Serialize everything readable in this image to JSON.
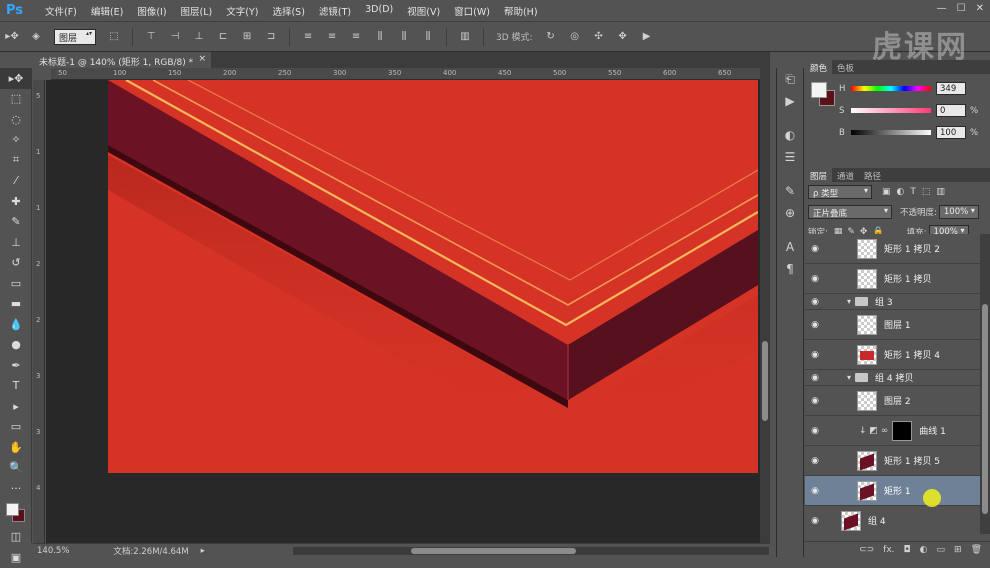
{
  "app": {
    "logo": "Ps"
  },
  "menu": [
    "文件(F)",
    "编辑(E)",
    "图像(I)",
    "图层(L)",
    "文字(Y)",
    "选择(S)",
    "滤镜(T)",
    "3D(D)",
    "视图(V)",
    "窗口(W)",
    "帮助(H)"
  ],
  "window_controls": [
    "—",
    "☐",
    "✕"
  ],
  "options_bar": {
    "select_value": "图层",
    "mode_3d_label": "3D 模式:"
  },
  "watermark": "虎课网",
  "document_tab": {
    "title": "未标题-1 @ 140% (矩形 1, RGB/8) *",
    "close": "×"
  },
  "ruler_top_ticks": [
    "50",
    "100",
    "150",
    "200",
    "250",
    "300",
    "350",
    "400",
    "450",
    "500",
    "550",
    "600",
    "650"
  ],
  "ruler_left_ticks": [
    "5",
    "1",
    "1",
    "2",
    "2",
    "3",
    "3",
    "4"
  ],
  "status": {
    "zoom": "140.5%",
    "doc_info": "文档:2.26M/4.64M"
  },
  "colors": {
    "canvas": "#d53325",
    "frame_side": "#6b1224",
    "gold_line": "#f6b85a",
    "fg": "#f3f3f3",
    "bg": "#5b0f19"
  },
  "color_panel": {
    "tabs": [
      "颜色",
      "色板"
    ],
    "sliders": [
      {
        "label": "H",
        "value": "349",
        "unit": ""
      },
      {
        "label": "S",
        "value": "0",
        "unit": "%"
      },
      {
        "label": "B",
        "value": "100",
        "unit": "%"
      }
    ]
  },
  "layers_panel": {
    "tabs": [
      "图层",
      "通道",
      "路径"
    ],
    "filter_label": "ρ 类型",
    "blend_mode": "正片叠底",
    "opacity_label": "不透明度:",
    "opacity_value": "100%",
    "lock_label": "锁定:",
    "fill_label": "填充:",
    "fill_value": "100%",
    "layers": [
      {
        "name": "矩形 1 拷贝 2",
        "kind": "layer",
        "thumb": "blank",
        "selected": false
      },
      {
        "name": "矩形 1 拷贝",
        "kind": "layer",
        "thumb": "blank",
        "selected": false
      },
      {
        "name": "组 3",
        "kind": "group",
        "thumb": "",
        "selected": false
      },
      {
        "name": "图层 1",
        "kind": "layer",
        "thumb": "blank",
        "selected": false
      },
      {
        "name": "矩形 1 拷贝 4",
        "kind": "layer",
        "thumb": "red",
        "selected": false
      },
      {
        "name": "组 4 拷贝",
        "kind": "group",
        "thumb": "",
        "selected": false
      },
      {
        "name": "图层 2",
        "kind": "layer",
        "thumb": "blank",
        "selected": false
      },
      {
        "name": "曲线 1",
        "kind": "adjustment",
        "thumb": "mask",
        "selected": false
      },
      {
        "name": "矩形 1 拷贝 5",
        "kind": "layer",
        "thumb": "dark",
        "selected": false
      },
      {
        "name": "矩形 1",
        "kind": "layer",
        "thumb": "dark",
        "selected": true
      },
      {
        "name": "组 4",
        "kind": "layer",
        "thumb": "dark",
        "selected": false
      }
    ]
  }
}
